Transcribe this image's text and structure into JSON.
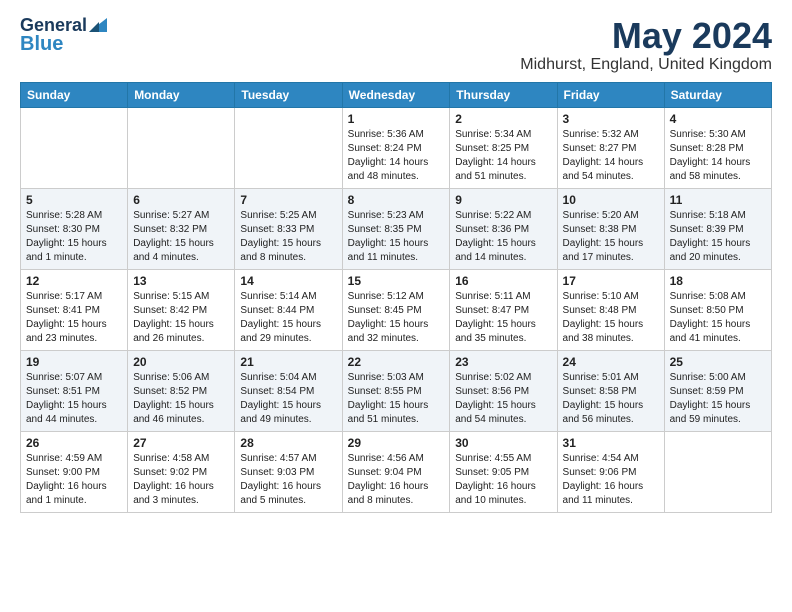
{
  "logo": {
    "text_general": "General",
    "text_blue": "Blue"
  },
  "title": "May 2024",
  "subtitle": "Midhurst, England, United Kingdom",
  "weekdays": [
    "Sunday",
    "Monday",
    "Tuesday",
    "Wednesday",
    "Thursday",
    "Friday",
    "Saturday"
  ],
  "weeks": [
    [
      {
        "day": "",
        "info": ""
      },
      {
        "day": "",
        "info": ""
      },
      {
        "day": "",
        "info": ""
      },
      {
        "day": "1",
        "info": "Sunrise: 5:36 AM\nSunset: 8:24 PM\nDaylight: 14 hours\nand 48 minutes."
      },
      {
        "day": "2",
        "info": "Sunrise: 5:34 AM\nSunset: 8:25 PM\nDaylight: 14 hours\nand 51 minutes."
      },
      {
        "day": "3",
        "info": "Sunrise: 5:32 AM\nSunset: 8:27 PM\nDaylight: 14 hours\nand 54 minutes."
      },
      {
        "day": "4",
        "info": "Sunrise: 5:30 AM\nSunset: 8:28 PM\nDaylight: 14 hours\nand 58 minutes."
      }
    ],
    [
      {
        "day": "5",
        "info": "Sunrise: 5:28 AM\nSunset: 8:30 PM\nDaylight: 15 hours\nand 1 minute."
      },
      {
        "day": "6",
        "info": "Sunrise: 5:27 AM\nSunset: 8:32 PM\nDaylight: 15 hours\nand 4 minutes."
      },
      {
        "day": "7",
        "info": "Sunrise: 5:25 AM\nSunset: 8:33 PM\nDaylight: 15 hours\nand 8 minutes."
      },
      {
        "day": "8",
        "info": "Sunrise: 5:23 AM\nSunset: 8:35 PM\nDaylight: 15 hours\nand 11 minutes."
      },
      {
        "day": "9",
        "info": "Sunrise: 5:22 AM\nSunset: 8:36 PM\nDaylight: 15 hours\nand 14 minutes."
      },
      {
        "day": "10",
        "info": "Sunrise: 5:20 AM\nSunset: 8:38 PM\nDaylight: 15 hours\nand 17 minutes."
      },
      {
        "day": "11",
        "info": "Sunrise: 5:18 AM\nSunset: 8:39 PM\nDaylight: 15 hours\nand 20 minutes."
      }
    ],
    [
      {
        "day": "12",
        "info": "Sunrise: 5:17 AM\nSunset: 8:41 PM\nDaylight: 15 hours\nand 23 minutes."
      },
      {
        "day": "13",
        "info": "Sunrise: 5:15 AM\nSunset: 8:42 PM\nDaylight: 15 hours\nand 26 minutes."
      },
      {
        "day": "14",
        "info": "Sunrise: 5:14 AM\nSunset: 8:44 PM\nDaylight: 15 hours\nand 29 minutes."
      },
      {
        "day": "15",
        "info": "Sunrise: 5:12 AM\nSunset: 8:45 PM\nDaylight: 15 hours\nand 32 minutes."
      },
      {
        "day": "16",
        "info": "Sunrise: 5:11 AM\nSunset: 8:47 PM\nDaylight: 15 hours\nand 35 minutes."
      },
      {
        "day": "17",
        "info": "Sunrise: 5:10 AM\nSunset: 8:48 PM\nDaylight: 15 hours\nand 38 minutes."
      },
      {
        "day": "18",
        "info": "Sunrise: 5:08 AM\nSunset: 8:50 PM\nDaylight: 15 hours\nand 41 minutes."
      }
    ],
    [
      {
        "day": "19",
        "info": "Sunrise: 5:07 AM\nSunset: 8:51 PM\nDaylight: 15 hours\nand 44 minutes."
      },
      {
        "day": "20",
        "info": "Sunrise: 5:06 AM\nSunset: 8:52 PM\nDaylight: 15 hours\nand 46 minutes."
      },
      {
        "day": "21",
        "info": "Sunrise: 5:04 AM\nSunset: 8:54 PM\nDaylight: 15 hours\nand 49 minutes."
      },
      {
        "day": "22",
        "info": "Sunrise: 5:03 AM\nSunset: 8:55 PM\nDaylight: 15 hours\nand 51 minutes."
      },
      {
        "day": "23",
        "info": "Sunrise: 5:02 AM\nSunset: 8:56 PM\nDaylight: 15 hours\nand 54 minutes."
      },
      {
        "day": "24",
        "info": "Sunrise: 5:01 AM\nSunset: 8:58 PM\nDaylight: 15 hours\nand 56 minutes."
      },
      {
        "day": "25",
        "info": "Sunrise: 5:00 AM\nSunset: 8:59 PM\nDaylight: 15 hours\nand 59 minutes."
      }
    ],
    [
      {
        "day": "26",
        "info": "Sunrise: 4:59 AM\nSunset: 9:00 PM\nDaylight: 16 hours\nand 1 minute."
      },
      {
        "day": "27",
        "info": "Sunrise: 4:58 AM\nSunset: 9:02 PM\nDaylight: 16 hours\nand 3 minutes."
      },
      {
        "day": "28",
        "info": "Sunrise: 4:57 AM\nSunset: 9:03 PM\nDaylight: 16 hours\nand 5 minutes."
      },
      {
        "day": "29",
        "info": "Sunrise: 4:56 AM\nSunset: 9:04 PM\nDaylight: 16 hours\nand 8 minutes."
      },
      {
        "day": "30",
        "info": "Sunrise: 4:55 AM\nSunset: 9:05 PM\nDaylight: 16 hours\nand 10 minutes."
      },
      {
        "day": "31",
        "info": "Sunrise: 4:54 AM\nSunset: 9:06 PM\nDaylight: 16 hours\nand 11 minutes."
      },
      {
        "day": "",
        "info": ""
      }
    ]
  ]
}
